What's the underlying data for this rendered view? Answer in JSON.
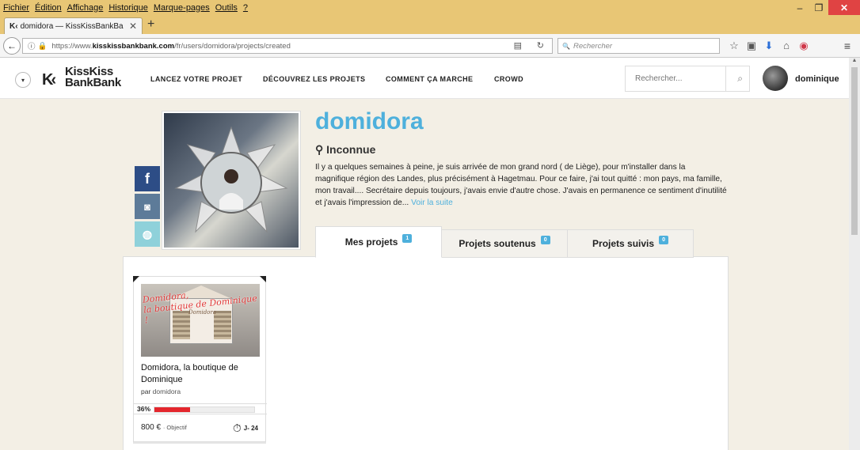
{
  "browser": {
    "menu": [
      "Fichier",
      "Édition",
      "Affichage",
      "Historique",
      "Marque-pages",
      "Outils",
      "?"
    ],
    "window_controls": {
      "minimize": "–",
      "restore": "❐",
      "close": "✕"
    },
    "tab": {
      "favicon": "K‹",
      "title": "domidora — KissKissBankBa",
      "close": "✕"
    },
    "new_tab": "+",
    "back": "←",
    "url": {
      "prefix": "https://www.",
      "domain": "kisskissbankbank.com",
      "path": "/fr/users/domidora/projects/created"
    },
    "reader_icon": "▤",
    "reload_icon": "↻",
    "search_placeholder": "Rechercher",
    "search_icon": "🔍",
    "toolbar_icons": {
      "star": "☆",
      "clipboard": "▣",
      "download": "⬇",
      "home": "⌂",
      "pocket": "◉"
    },
    "menu_icon": "≡"
  },
  "site": {
    "logo_mark": "K‹",
    "logo_line1": "KissKiss",
    "logo_line2": "BankBank",
    "chevron": "▾",
    "nav": [
      "LANCEZ VOTRE PROJET",
      "DÉCOUVREZ LES PROJETS",
      "COMMENT ÇA MARCHE",
      "CROWD"
    ],
    "search_placeholder": "Rechercher...",
    "search_icon": "⌕",
    "user_name": "dominique"
  },
  "profile": {
    "social": {
      "facebook": "f",
      "instagram": "◙",
      "website": "◍"
    },
    "name": "domidora",
    "location_icon": "⚲",
    "location": "Inconnue",
    "bio": "Il y a quelques semaines à peine, je suis arrivée de mon grand nord ( de Liège), pour m'installer dans la magnifique région des Landes, plus précisément à Hagetmau. Pour ce faire, j'ai tout quitté : mon pays, ma famille, mon travail.... Secrétaire depuis toujours, j'avais envie d'autre chose. J'avais en permanence ce sentiment d'inutilité et j'avais l'impression de...",
    "bio_more": "Voir la suite"
  },
  "tabs": [
    {
      "label": "Mes projets",
      "count": "1"
    },
    {
      "label": "Projets soutenus",
      "count": "0"
    },
    {
      "label": "Projets suivis",
      "count": "0"
    }
  ],
  "project": {
    "image_caption_1": "Domidora,",
    "image_caption_2": "la boutique de Dominique !",
    "image_sign": "Domidora",
    "title": "Domidora, la boutique de Dominique",
    "by_label": "par",
    "author": "domidora",
    "progress_label": "36%",
    "progress": 0.36,
    "goal_amount": "800 €",
    "goal_label": "· Objectif",
    "days_icon": "⏱",
    "days_left": "J- 24"
  },
  "colors": {
    "brand_blue": "#4eb0dc",
    "progress_red": "#e4262d",
    "firefox_bar": "#e8c675"
  }
}
